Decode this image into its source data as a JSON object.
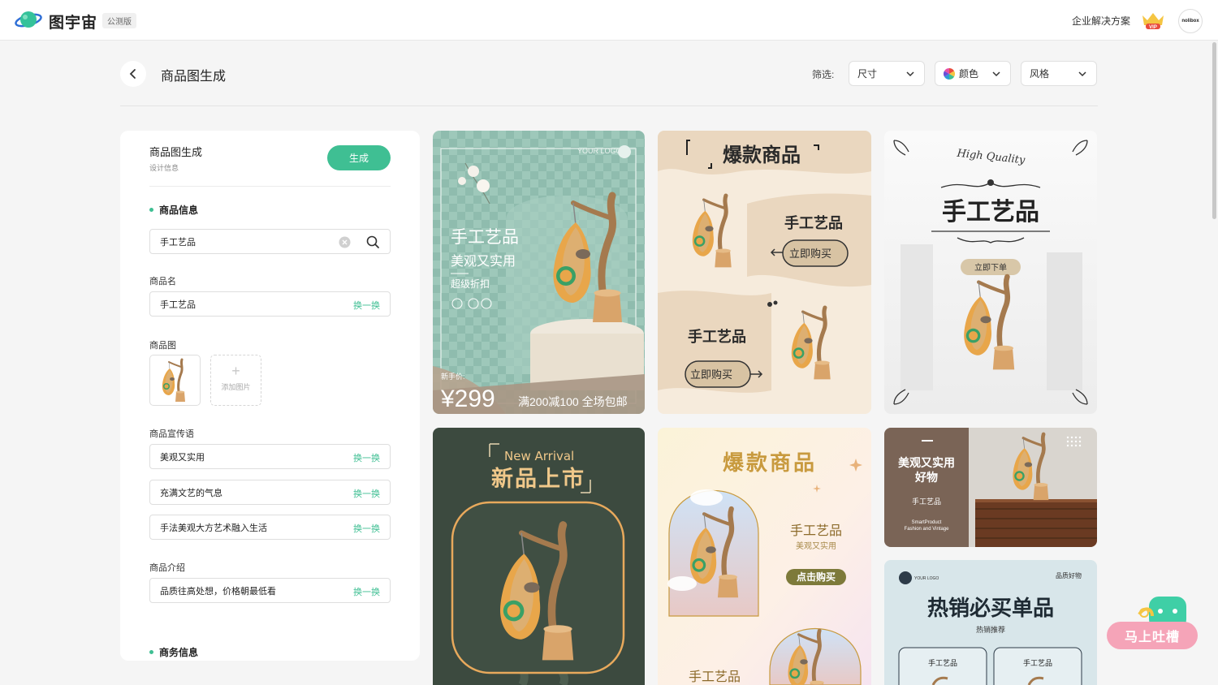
{
  "header": {
    "brand": "图宇宙",
    "beta_badge": "公测版",
    "enterprise_link": "企业解决方案",
    "vip_badge": "VIP",
    "avatar_text": "nolibox"
  },
  "page": {
    "title": "商品图生成",
    "filter_label": "筛选:",
    "filters": [
      {
        "label": "尺寸"
      },
      {
        "label": "颜色"
      },
      {
        "label": "风格"
      }
    ]
  },
  "panel": {
    "title": "商品图生成",
    "subtitle": "设计信息",
    "generate_label": "生成",
    "section_product": "商品信息",
    "search_value": "手工艺品",
    "name_label": "商品名",
    "name_value": "手工艺品",
    "swap_label": "换一换",
    "image_label": "商品图",
    "add_image_label": "添加图片",
    "slogan_label": "商品宣传语",
    "slogans": [
      "美观又实用",
      "充满文艺的气息",
      "手法美观大方艺术融入生活"
    ],
    "intro_label": "商品介绍",
    "intro_value": "品质往高处想，价格朝最低看",
    "section_business": "商务信息"
  },
  "cards": {
    "c1": {
      "logo": "YOUR LOGO",
      "title": "手工艺品",
      "slogan": "美观又实用",
      "tag": "超级折扣",
      "price_label": "新手价:",
      "price": "¥299",
      "promo": "满200减100 全场包邮"
    },
    "c2": {
      "title": "爆款商品",
      "name1": "手工艺品",
      "btn1": "立即购买",
      "name2": "手工艺品",
      "btn2": "立即购买"
    },
    "c3": {
      "top": "High Quality",
      "title": "手工艺品",
      "btn": "立即下单"
    },
    "c4": {
      "eng": "New Arrival",
      "title": "新品上市"
    },
    "c5": {
      "title": "爆款商品",
      "name": "手工艺品",
      "slogan": "美观又实用",
      "btn": "点击购买",
      "name2": "手工艺品"
    },
    "c6": {
      "title1": "美观又实用",
      "title2": "好物",
      "name": "手工艺品",
      "eng1": "SmartProduct",
      "eng2": "Fashion and Vintage"
    },
    "c7": {
      "logo": "YOUR LOGO",
      "quality": "品质好物",
      "title": "热销必买单品",
      "sub": "热销推荐",
      "item1": "手工艺品",
      "item2": "手工艺品"
    }
  },
  "feedback": {
    "label": "马上吐槽"
  }
}
